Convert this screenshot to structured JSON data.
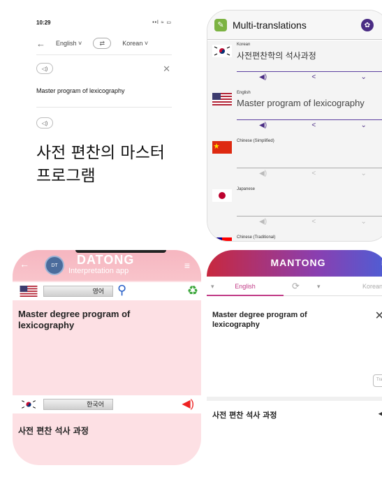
{
  "ios_translate": {
    "status_time": "10:29",
    "status_icons": "••l ≈ ▭",
    "back_icon": "←",
    "source_lang": "English",
    "target_lang": "Korean",
    "input_text": "Master program of lexicography",
    "result_text": "사전 편찬의 마스터 프로그램"
  },
  "multi_translations": {
    "title": "Multi-translations",
    "entries": [
      {
        "lang": "Korean",
        "text": "사전편찬학의 석사과정"
      },
      {
        "lang": "English",
        "text": "Master program of lexicography"
      },
      {
        "lang": "Chinese (Simplified)",
        "text": ""
      },
      {
        "lang": "Japanese",
        "text": ""
      },
      {
        "lang": "Chinese (Traditional)",
        "text": ""
      }
    ]
  },
  "datong": {
    "brand": "DATONG",
    "subtitle": "Interpretation app",
    "logo_text": "DT",
    "source_lang": "영어",
    "source_text": "Master degree program of lexicography",
    "target_lang": "한국어",
    "target_text": "사전 편찬 석사 과정"
  },
  "mantong": {
    "brand": "MANTONG",
    "source_lang": "English",
    "target_lang": "Korean",
    "source_text": "Master degree program of lexicography",
    "translate_label": "Transla",
    "target_text": "사전 편찬 석사 과정"
  },
  "colors": {
    "mantong_accent": "#c13a86",
    "datong_bg": "#fde0e4",
    "multi_accent": "#4a2c84"
  }
}
